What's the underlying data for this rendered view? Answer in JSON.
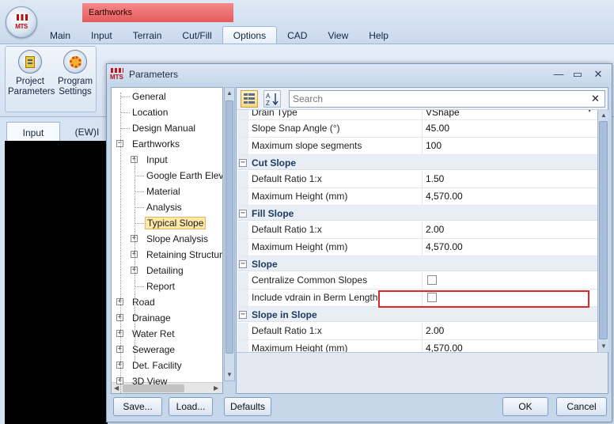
{
  "app": {
    "title": "Earthworks",
    "logo_text": "MTS"
  },
  "ribbon": {
    "tabs": [
      "Main",
      "Input",
      "Terrain",
      "Cut/Fill",
      "Options",
      "CAD",
      "View",
      "Help"
    ],
    "active_tab": "Options",
    "buttons": [
      {
        "line1": "Project",
        "line2": "Parameters"
      },
      {
        "line1": "Program",
        "line2": "Settings"
      }
    ]
  },
  "doc_tabs": [
    "Input",
    "(EW)I"
  ],
  "dialog": {
    "title": "Parameters",
    "minimize_glyph": "—",
    "maximize_glyph": "▭",
    "close_glyph": "✕",
    "search_placeholder": "Search",
    "search_clear_glyph": "✕",
    "buttons": {
      "save": "Save...",
      "load": "Load...",
      "defaults": "Defaults",
      "ok": "OK",
      "cancel": "Cancel"
    }
  },
  "tree": [
    {
      "label": "General",
      "expander": ""
    },
    {
      "label": "Location",
      "expander": ""
    },
    {
      "label": "Design Manual",
      "expander": ""
    },
    {
      "label": "Earthworks",
      "expander": "−"
    },
    {
      "label": "Input",
      "expander": "+"
    },
    {
      "label": "Google Earth Elevation",
      "expander": ""
    },
    {
      "label": "Material",
      "expander": ""
    },
    {
      "label": "Analysis",
      "expander": ""
    },
    {
      "label": "Typical Slope",
      "expander": "",
      "selected": true
    },
    {
      "label": "Slope Analysis",
      "expander": "+"
    },
    {
      "label": "Retaining Structures",
      "expander": "+"
    },
    {
      "label": "Detailing",
      "expander": "+"
    },
    {
      "label": "Report",
      "expander": ""
    },
    {
      "label": "Road",
      "expander": "+"
    },
    {
      "label": "Drainage",
      "expander": "+"
    },
    {
      "label": "Water Ret",
      "expander": "+"
    },
    {
      "label": "Sewerage",
      "expander": "+"
    },
    {
      "label": "Det. Facility",
      "expander": "+"
    },
    {
      "label": "3D View",
      "expander": "+"
    }
  ],
  "properties": [
    {
      "kind": "prop",
      "name": "Drain Type",
      "value": "VShape",
      "dropdown": true
    },
    {
      "kind": "prop",
      "name": "Slope Snap Angle (°)",
      "value": "45.00"
    },
    {
      "kind": "prop",
      "name": "Maximum slope segments",
      "value": "100"
    },
    {
      "kind": "cat",
      "name": "Cut Slope",
      "expander": "−"
    },
    {
      "kind": "prop",
      "name": "Default Ratio 1:x",
      "value": "1.50"
    },
    {
      "kind": "prop",
      "name": "Maximum Height (mm)",
      "value": "4,570.00"
    },
    {
      "kind": "cat",
      "name": "Fill Slope",
      "expander": "−"
    },
    {
      "kind": "prop",
      "name": "Default Ratio 1:x",
      "value": "2.00"
    },
    {
      "kind": "prop",
      "name": "Maximum Height (mm)",
      "value": "4,570.00"
    },
    {
      "kind": "cat",
      "name": "Slope",
      "expander": "−"
    },
    {
      "kind": "check",
      "name": "Centralize Common Slopes",
      "checked": false
    },
    {
      "kind": "check",
      "name": "Include vdrain in Berm Length",
      "checked": false,
      "highlighted": true
    },
    {
      "kind": "cat",
      "name": "Slope in Slope",
      "expander": "−"
    },
    {
      "kind": "prop",
      "name": "Default Ratio 1:x",
      "value": "2.00"
    },
    {
      "kind": "prop",
      "name": "Maximum Height (mm)",
      "value": "4,570.00"
    }
  ],
  "colors": {
    "title_tab": "#e55a5a",
    "highlight_border": "#e0262b",
    "selected_tree_item": "#fde8a8"
  }
}
